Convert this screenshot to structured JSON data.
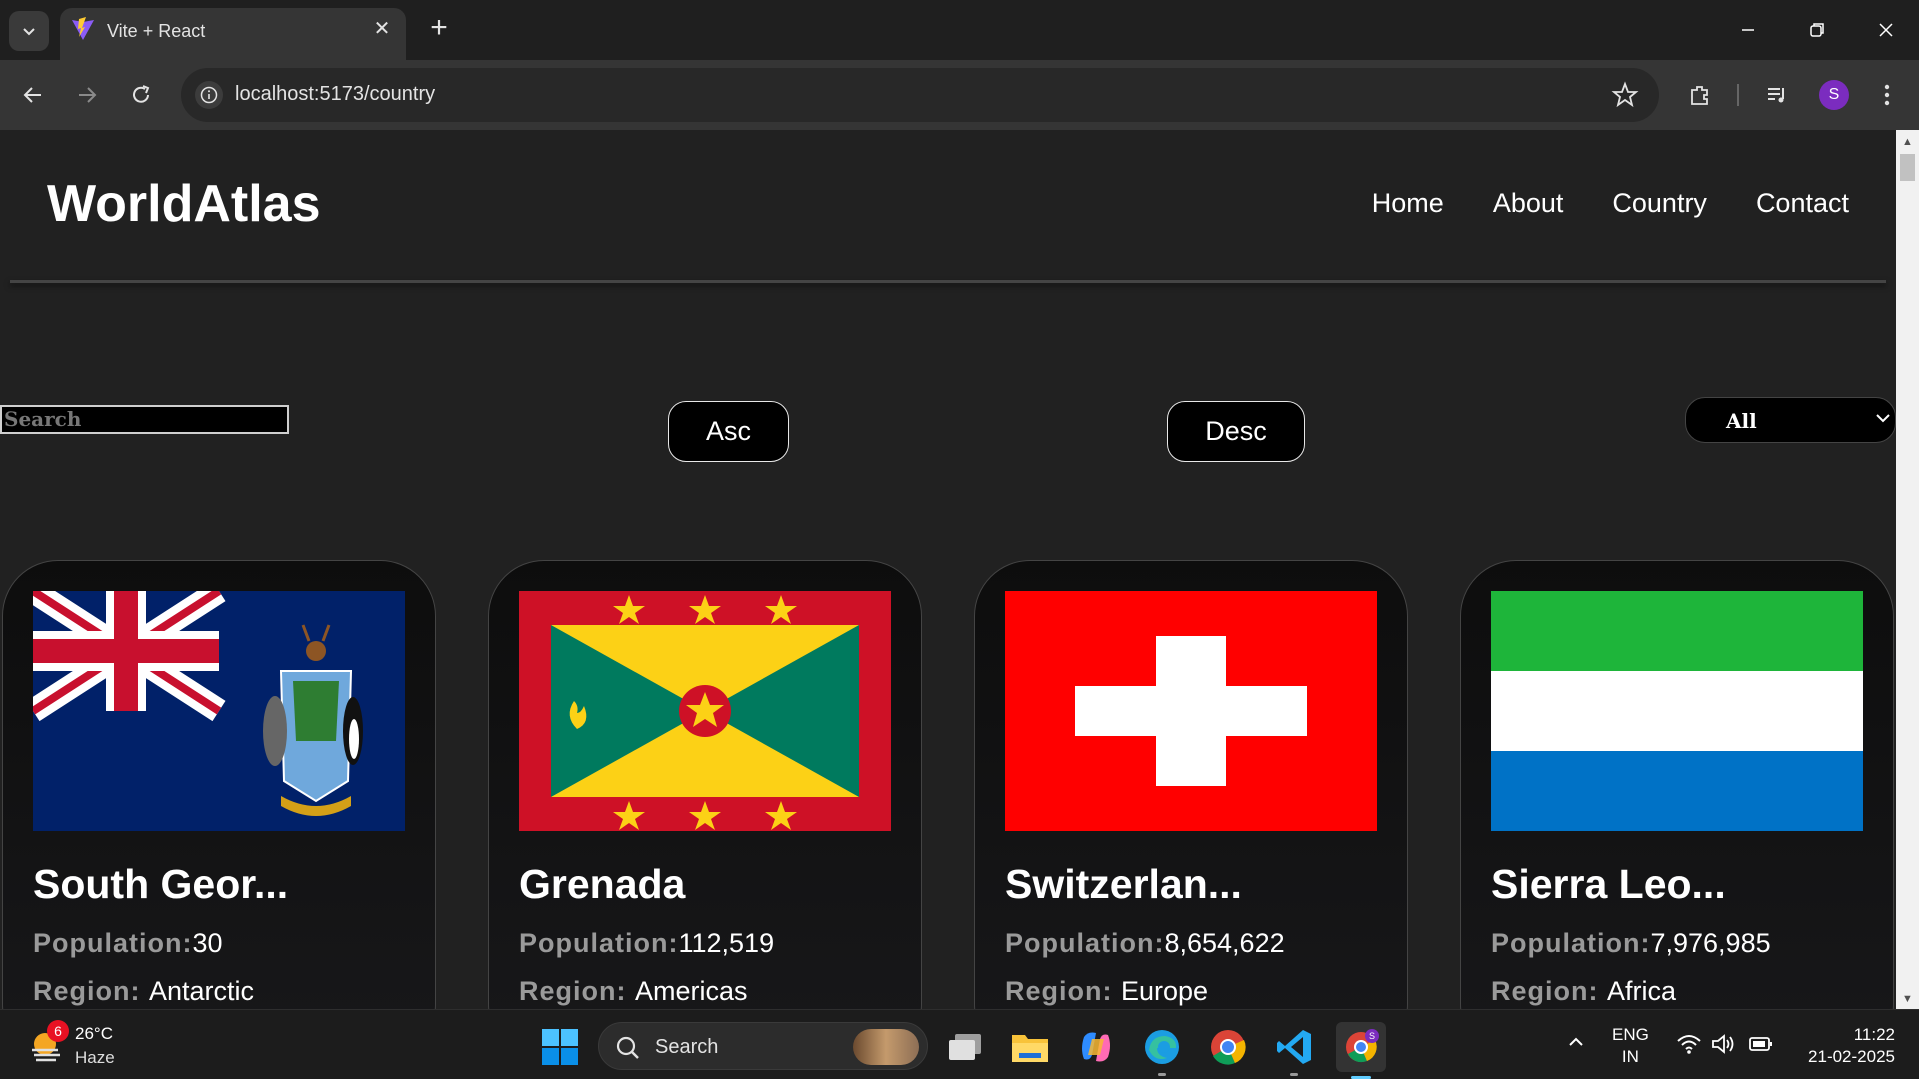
{
  "browser": {
    "tab_title": "Vite + React",
    "url": "localhost:5173/country",
    "profile_initial": "S"
  },
  "site": {
    "brand": "WorldAtlas",
    "nav": [
      "Home",
      "About",
      "Country",
      "Contact"
    ]
  },
  "controls": {
    "search_placeholder": "Search",
    "asc_label": "Asc",
    "desc_label": "Desc",
    "filter_selected": "All"
  },
  "labels": {
    "population": "Population:",
    "region": "Region: "
  },
  "countries": [
    {
      "name": "South Geor...",
      "population": "30",
      "region": "Antarctic",
      "flag": "south-georgia-flag"
    },
    {
      "name": "Grenada",
      "population": "112,519",
      "region": "Americas",
      "flag": "grenada-flag"
    },
    {
      "name": "Switzerlan...",
      "population": "8,654,622",
      "region": "Europe",
      "flag": "switzerland-flag"
    },
    {
      "name": "Sierra Leo...",
      "population": "7,976,985",
      "region": "Africa",
      "flag": "sierra-leone-flag"
    }
  ],
  "taskbar": {
    "weather_temp": "26°C",
    "weather_desc": "Haze",
    "weather_badge": "6",
    "search_label": "Search",
    "lang_line1": "ENG",
    "lang_line2": "IN",
    "time": "11:22",
    "date": "21-02-2025"
  },
  "colors": {
    "page_bg": "#212121",
    "card_bg": "#0d0d0d",
    "label_gray": "#9a9a9a",
    "profile_purple": "#7b2cbf",
    "active_indicator": "#60cdff"
  }
}
